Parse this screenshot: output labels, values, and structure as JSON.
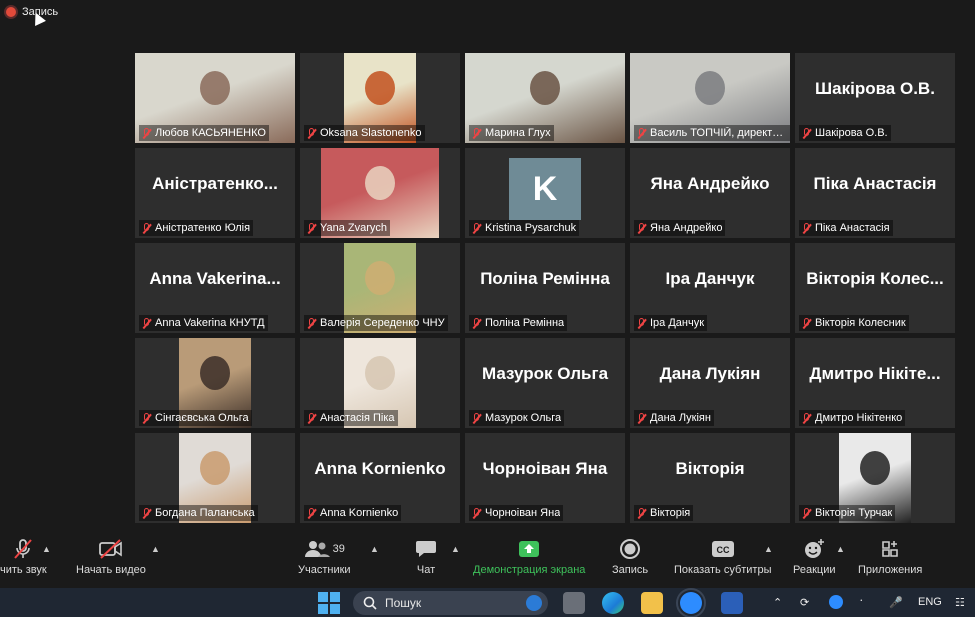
{
  "recording": {
    "label": "Запись"
  },
  "participants": [
    {
      "display": "",
      "label": "Любов КАСЬЯНЕНКО",
      "video": true,
      "bg": [
        "#d9d7cd",
        "#8a6b5a"
      ]
    },
    {
      "display": "",
      "label": "Oksana Slastonenko",
      "video": true,
      "bg": [
        "#e8e3c8",
        "#c2511f"
      ]
    },
    {
      "display": "",
      "label": "Марина Глух",
      "video": true,
      "bg": [
        "#d5d7cf",
        "#6a5444"
      ]
    },
    {
      "display": "",
      "label": "Василь ТОПЧІЙ, директор ...",
      "video": true,
      "active": true,
      "bg": [
        "#c9c9c4",
        "#7b7c80"
      ]
    },
    {
      "display": "Шакірова О.В.",
      "label": "Шакірова О.В.",
      "video": false
    },
    {
      "display": "Аністратенко...",
      "label": "Аністратенко Юлія",
      "video": false
    },
    {
      "display": "",
      "label": "Yana Zvarych",
      "video": true,
      "bg": [
        "#c65a5c",
        "#e9d4c0"
      ]
    },
    {
      "display": "",
      "label": "Kristina Pysarchuk",
      "video": false,
      "avatar": "K"
    },
    {
      "display": "Яна Андрейко",
      "label": "Яна Андрейко",
      "video": false
    },
    {
      "display": "Піка Анастасія",
      "label": "Піка Анастасія",
      "video": false
    },
    {
      "display": "Anna  Vakerina...",
      "label": "Anna Vakerina КНУТД",
      "video": false
    },
    {
      "display": "",
      "label": "Валерія Середенко ЧНУ",
      "video": true,
      "bg": [
        "#a9b677",
        "#cfae72"
      ]
    },
    {
      "display": "Поліна Ремінна",
      "label": "Поліна Ремінна",
      "video": false
    },
    {
      "display": "Іра Данчук",
      "label": "Іра Данчук",
      "video": false
    },
    {
      "display": "Вікторія Колес...",
      "label": "Вікторія Колесник",
      "video": false
    },
    {
      "display": "",
      "label": "Сінгаєвська Ольга",
      "video": true,
      "bg": [
        "#b99b78",
        "#3b2e28"
      ]
    },
    {
      "display": "",
      "label": "Анастасія Піка",
      "video": true,
      "bg": [
        "#eee6dc",
        "#d6c6b2"
      ]
    },
    {
      "display": "Мазурок Ольга",
      "label": "Мазурок Ольга",
      "video": false
    },
    {
      "display": "Дана Лукіян",
      "label": "Дана Лукіян",
      "video": false
    },
    {
      "display": "Дмитро  Нікіте...",
      "label": "Дмитро Нікітенко",
      "video": false
    },
    {
      "display": "",
      "label": "Богдана Паланська",
      "video": true,
      "bg": [
        "#e0dbd6",
        "#c99b6f"
      ]
    },
    {
      "display": "Anna Kornienko",
      "label": "Anna Kornienko",
      "video": false
    },
    {
      "display": "Чорноіван Яна",
      "label": "Чорноіван Яна",
      "video": false
    },
    {
      "display": "Вікторія",
      "label": "Вікторія",
      "video": false
    },
    {
      "display": "",
      "label": "Вікторія Турчак",
      "video": true,
      "bg": [
        "#e9e9e9",
        "#222222"
      ]
    }
  ],
  "toolbar": {
    "audio": "чить звук",
    "video": "Начать видео",
    "participants": "Участники",
    "participants_count": "39",
    "chat": "Чат",
    "share": "Демонстрация экрана",
    "record": "Запись",
    "captions": "Показать субтитры",
    "reactions": "Реакции",
    "apps": "Приложения"
  },
  "taskbar": {
    "search_placeholder": "Пошук",
    "language": "ENG"
  },
  "colors": {
    "active_speaker": "#c7e36a",
    "share_green": "#3ec15b",
    "muted_red": "#e44444"
  }
}
